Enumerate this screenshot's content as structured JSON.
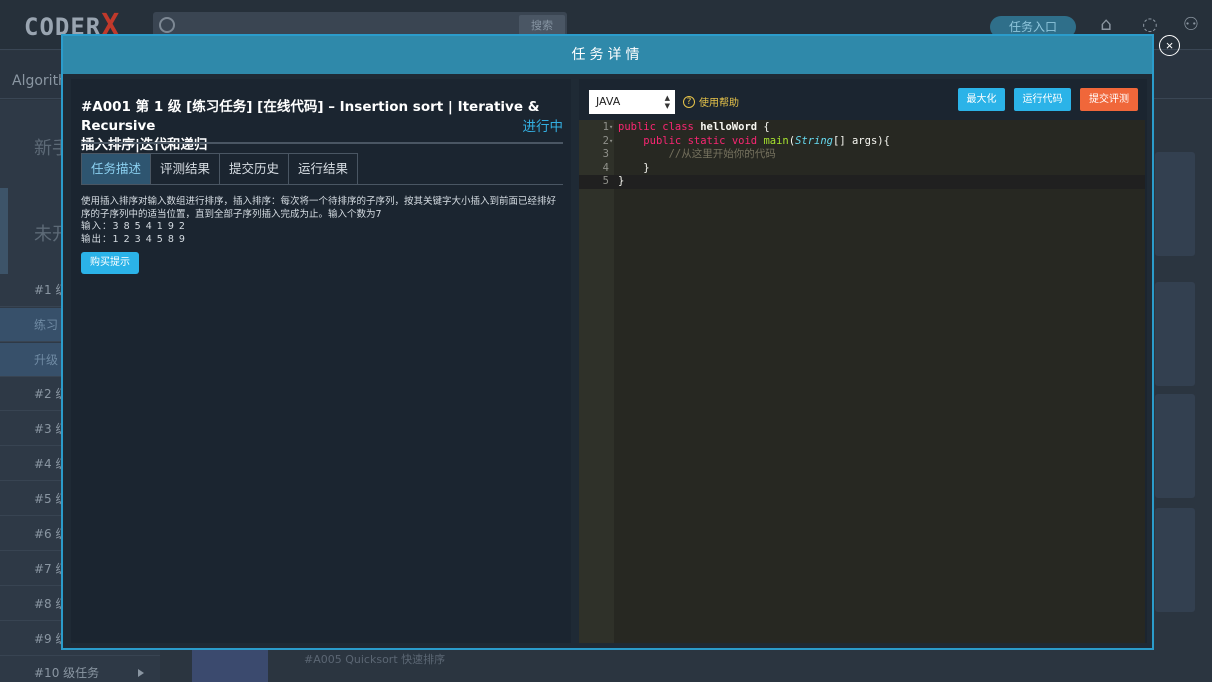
{
  "background": {
    "logo_text": "CODER",
    "logo_x": "X",
    "search_button": "搜索",
    "task_entry": "任务入口",
    "nav_item": "Algorith",
    "sidebar_heading_1": "新手",
    "sidebar_heading_2": "未开",
    "sidebar_items": [
      "#1 级",
      "练习",
      "升级",
      "#2 级",
      "#3 级",
      "#4 级",
      "#5 级",
      "#6 级",
      "#7 级",
      "#8 级",
      "#9 级",
      "#10 级任务"
    ],
    "footer_task": "#A005 Quicksort 快速排序"
  },
  "modal": {
    "title": "任务详情",
    "close_icon": "×",
    "task": {
      "title_line1": "#A001  第 1 级 [练习任务] [在线代码] – Insertion sort | Iterative & Recursive",
      "title_line2": "插入排序|迭代和递归",
      "status": "进行中"
    },
    "tabs": [
      "任务描述",
      "评测结果",
      "提交历史",
      "运行结果"
    ],
    "description": {
      "text": "使用插入排序对输入数组进行排序，插入排序：每次将一个待排序的子序列，按其关键字大小插入到前面已经排好序的子序列中的适当位置，直到全部子序列插入完成为止。输入个数为7",
      "input": "输入：3 8 5 4 1 9 2",
      "output": "输出：1 2 3 4 5 8 9"
    },
    "buy_hint_button": "购买提示",
    "editor": {
      "language": "JAVA",
      "help_label": "使用帮助",
      "maximize_button": "最大化",
      "run_button": "运行代码",
      "submit_button": "提交评测",
      "line_numbers": [
        "1",
        "2",
        "3",
        "4",
        "5"
      ],
      "code": {
        "l1_kw1": "public",
        "l1_kw2": "class",
        "l1_name": "helloWord",
        "l1_rest": " {",
        "l2_kw1": "public",
        "l2_kw2": "static",
        "l2_kw3": "void",
        "l2_fn": "main",
        "l2_type": "String",
        "l2_rest": "[] args){",
        "l3_comment": "//从这里开始你的代码",
        "l4": "}",
        "l5": "}"
      }
    }
  },
  "colors": {
    "modal_header": "#2f89aa",
    "accent_blue": "#2bb3e8",
    "submit_orange": "#f0673a",
    "status_blue": "#33aee0"
  }
}
